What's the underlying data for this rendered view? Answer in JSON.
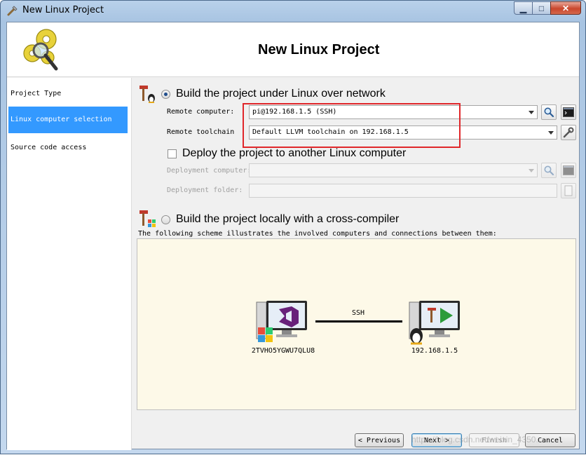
{
  "window": {
    "title": "New Linux Project",
    "buttons": {
      "minimize": "▁",
      "maximize": "□",
      "close": "✕"
    }
  },
  "header": {
    "title": "New Linux Project"
  },
  "sidebar": {
    "items": [
      {
        "label": "Project Type",
        "active": false
      },
      {
        "label": "Linux computer selection",
        "active": true
      },
      {
        "label": "Source code access",
        "active": false
      }
    ]
  },
  "network_build": {
    "label": "Build the project under Linux over network",
    "selected": true,
    "remote_computer": {
      "label": "Remote computer:",
      "value": "pi@192.168.1.5 (SSH)"
    },
    "remote_toolchain": {
      "label": "Remote toolchain",
      "value": "Default LLVM toolchain on 192.168.1.5"
    }
  },
  "deploy": {
    "label": "Deploy the project to another Linux computer",
    "checked": false,
    "deployment_computer": {
      "label": "Deployment computer:",
      "value": ""
    },
    "deployment_folder": {
      "label": "Deployment folder:",
      "value": ""
    }
  },
  "cross_build": {
    "label": "Build the project locally with a cross-compiler",
    "selected": false
  },
  "scheme": {
    "caption": "The following scheme illustrates the involved computers and connections between them:",
    "local_host": "2TVHO5YGWU7QLU8",
    "remote_host": "192.168.1.5",
    "connection": "SSH"
  },
  "footer": {
    "previous": "< Previous",
    "next": "Next >",
    "finish": "Finish",
    "cancel": "Cancel",
    "watermark": "https://blog.csdn.net/weixin_4350..."
  },
  "colors": {
    "selection": "#3399ff",
    "highlight_box": "#e0262a",
    "scheme_bg": "#fdf9e8"
  }
}
